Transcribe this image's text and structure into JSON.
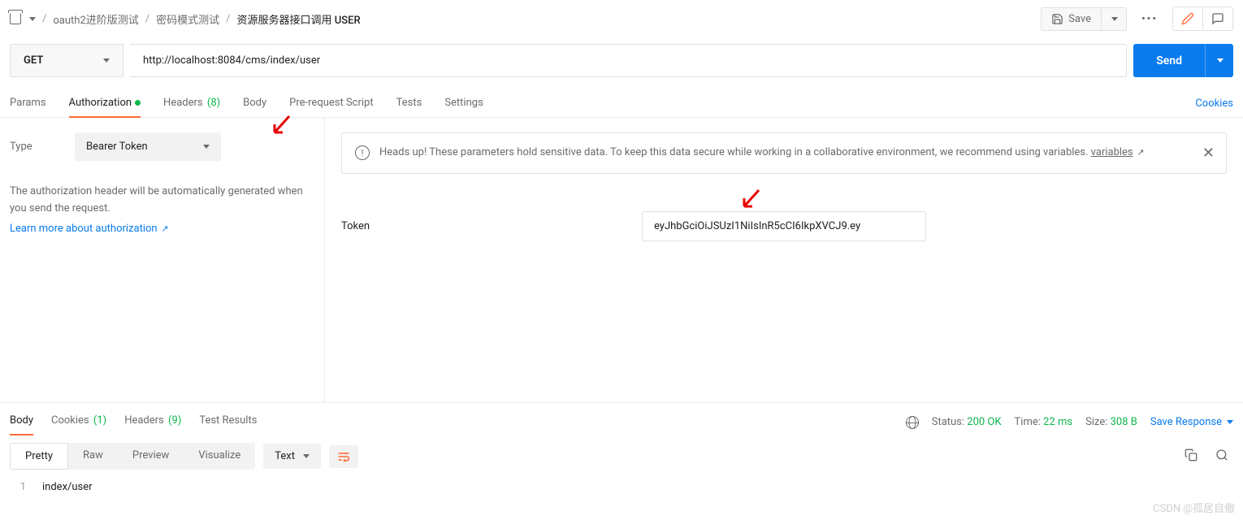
{
  "breadcrumb": {
    "item1": "oauth2进阶版测试",
    "item2": "密码模式测试",
    "current": "资源服务器接口调用 USER"
  },
  "toolbar": {
    "save": "Save"
  },
  "request": {
    "method": "GET",
    "url": "http://localhost:8084/cms/index/user",
    "send": "Send"
  },
  "tabs": {
    "params": "Params",
    "authorization": "Authorization",
    "headers": "Headers",
    "headers_count": "(8)",
    "body": "Body",
    "prerequest": "Pre-request Script",
    "tests": "Tests",
    "settings": "Settings",
    "cookies": "Cookies"
  },
  "auth": {
    "type_label": "Type",
    "type_value": "Bearer Token",
    "help1": "The authorization header will be automatically generated when you send the request.",
    "learn": "Learn more about authorization",
    "banner1": "Heads up! These parameters hold sensitive data. To keep this data secure while working in a collaborative environment, we recommend using variables. ",
    "banner_link": "variables",
    "token_label": "Token",
    "token_value": "eyJhbGciOiJSUzI1NiIsInR5cCI6IkpXVCJ9.ey"
  },
  "response": {
    "tabs": {
      "body": "Body",
      "cookies": "Cookies",
      "cookies_count": "(1)",
      "headers": "Headers",
      "headers_count": "(9)",
      "test_results": "Test Results"
    },
    "meta": {
      "status_label": "Status:",
      "status_value": "200 OK",
      "time_label": "Time:",
      "time_value": "22 ms",
      "size_label": "Size:",
      "size_value": "308 B",
      "save_response": "Save Response"
    },
    "views": {
      "pretty": "Pretty",
      "raw": "Raw",
      "preview": "Preview",
      "visualize": "Visualize",
      "lang": "Text"
    },
    "body_line1": "index/user"
  },
  "watermark": "CSDN @孤居自傲"
}
